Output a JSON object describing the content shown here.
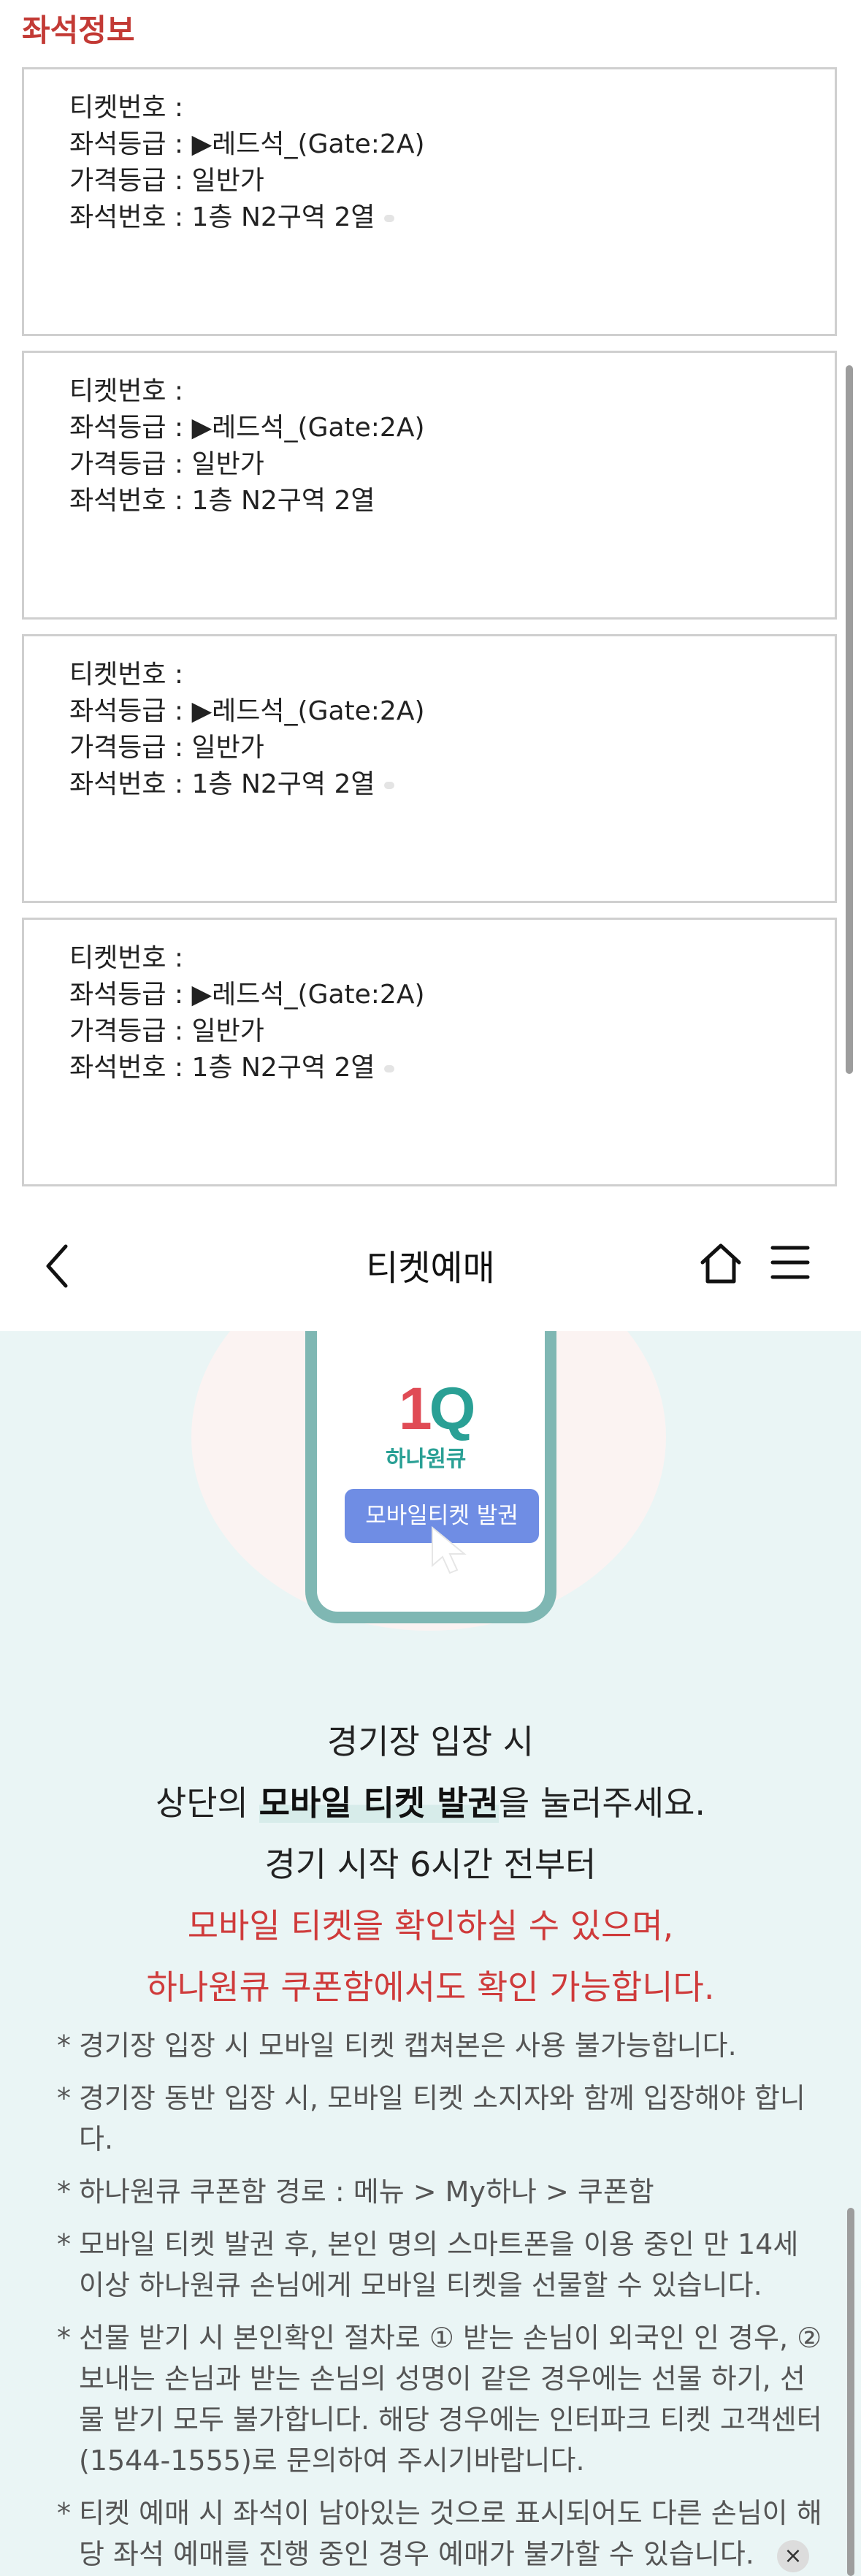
{
  "top": {
    "section_title": "좌석정보",
    "tickets": [
      {
        "ticket_no": "티켓번호 :",
        "seat_grade": "좌석등급 : ▶레드석_(Gate:2A)",
        "price_grade": "가격등급 : 일반가",
        "seat_no": "좌석번호 : 1층 N2구역 2열"
      },
      {
        "ticket_no": "티켓번호 :",
        "seat_grade": "좌석등급 : ▶레드석_(Gate:2A)",
        "price_grade": "가격등급 : 일반가",
        "seat_no": "좌석번호 : 1층 N2구역 2열"
      },
      {
        "ticket_no": "티켓번호 :",
        "seat_grade": "좌석등급 : ▶레드석_(Gate:2A)",
        "price_grade": "가격등급 : 일반가",
        "seat_no": "좌석번호 : 1층 N2구역 2열"
      },
      {
        "ticket_no": "티켓번호 :",
        "seat_grade": "좌석등급 : ▶레드석_(Gate:2A)",
        "price_grade": "가격등급 : 일반가",
        "seat_no": "좌석번호 : 1층 N2구역 2열"
      }
    ]
  },
  "nav": {
    "title": "티켓예매",
    "back_icon": "chevron-left-icon",
    "home_icon": "home-icon",
    "menu_icon": "hamburger-menu-icon"
  },
  "illustration": {
    "logo_mark": "1Q",
    "logo_text": "하나원큐",
    "button_label": "모바일티켓 발권"
  },
  "main_text": {
    "line1": "경기장 입장 시",
    "line2_pre": "상단의 ",
    "line2_bold": "모바일 티켓 발권",
    "line2_post": "을 눌러주세요.",
    "line3": "경기 시작 6시간 전부터",
    "line4": "모바일 티켓을 확인하실 수 있으며,",
    "line5": "하나원큐 쿠폰함에서도 확인 가능합니다."
  },
  "notes": [
    {
      "bullet": "*",
      "text": "경기장 입장 시 모바일 티켓 캡쳐본은 사용 불가능합니다."
    },
    {
      "bullet": "*",
      "text": "경기장 동반 입장 시, 모바일 티켓 소지자와 함께 입장해야 합니다."
    },
    {
      "bullet": "*",
      "text": "하나원큐 쿠폰함 경로 : 메뉴 > My하나 > 쿠폰함"
    },
    {
      "bullet": "*",
      "text": "모바일 티켓 발권 후, 본인 명의 스마트폰을 이용 중인 만 14세 이상 하나원큐 손님에게 모바일 티켓을 선물할 수 있습니다."
    },
    {
      "bullet": "*",
      "text": "선물 받기 시 본인확인 절차로 ① 받는 손님이 외국인 인 경우, ② 보내는 손님과 받는 손님의 성명이 같은 경우에는 선물 하기, 선물 받기 모두 불가합니다. 해당 경우에는 인터파크 티켓 고객센터(1544-1555)로 문의하여 주시기바랍니다."
    },
    {
      "bullet": "*",
      "text": "티켓 예매 시 좌석이 남아있는 것으로 표시되어도 다른 손님이 해당 좌석 예매를 진행 중인 경우 예매가 불가할 수 있습니다."
    }
  ],
  "close_label": "×",
  "colors": {
    "accent_red": "#c33a35",
    "bg_mint": "#eaf5f5",
    "button_blue": "#6f8de4",
    "brand_teal": "#2aa095"
  }
}
